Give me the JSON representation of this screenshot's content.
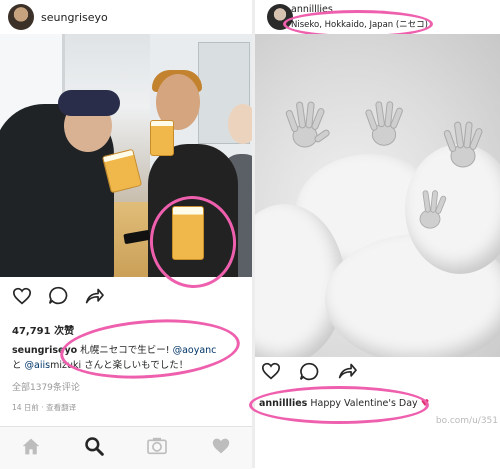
{
  "left_post": {
    "username": "seungriseyo",
    "likes": "47,791 次赞",
    "caption": {
      "author": "seungriseyo",
      "line1_text": " 札幌ニセコで生ビー!",
      "mention1": "@aoyanc",
      "line2_prefix": "と",
      "mention2": "@aiis",
      "line2_text": "mizuki さんと楽しいも",
      "line2_suffix": "でした！"
    },
    "view_comments": "全部1379条评论",
    "timestamp": "14 日前 · 查看翻译"
  },
  "right_post": {
    "username": "annilllies",
    "location": "Niseko, Hokkaido, Japan (ニセコ)",
    "comment": {
      "author": "annilllies",
      "text": " Happy Valentine's Day",
      "emoji": "♥"
    }
  },
  "watermark": "bo.com/u/351",
  "nav": {
    "items": [
      "home",
      "search",
      "camera",
      "heart",
      "profile"
    ]
  },
  "annotation_color": "#ee5fae",
  "icons": [
    "heart-icon",
    "comment-icon",
    "share-icon",
    "home-icon",
    "search-icon",
    "camera-icon"
  ]
}
